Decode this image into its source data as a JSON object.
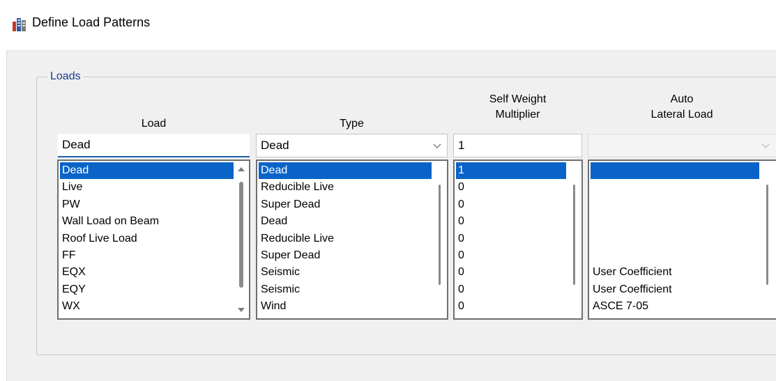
{
  "window": {
    "title": "Define Load Patterns"
  },
  "group": {
    "legend": "Loads"
  },
  "columns": {
    "load": {
      "header": "Load"
    },
    "type": {
      "header": "Type"
    },
    "self_weight": {
      "header_line1": "Self Weight",
      "header_line2": "Multiplier"
    },
    "auto_lateral": {
      "header_line1": "Auto",
      "header_line2": "Lateral Load"
    }
  },
  "inputs": {
    "load_name": "Dead",
    "type_selected": "Dead",
    "self_weight_value": "1",
    "auto_lateral_selected": ""
  },
  "lists": {
    "load": [
      "Dead",
      "Live",
      "PW",
      "Wall Load on Beam",
      "Roof Live Load",
      "FF",
      "EQX",
      "EQY",
      "WX"
    ],
    "type": [
      "Dead",
      "Reducible Live",
      "Super Dead",
      "Dead",
      "Reducible Live",
      "Super Dead",
      "Seismic",
      "Seismic",
      "Wind"
    ],
    "self_weight": [
      "1",
      "0",
      "0",
      "0",
      "0",
      "0",
      "0",
      "0",
      "0"
    ],
    "auto_lateral": [
      "",
      "",
      "",
      "",
      "",
      "",
      "User Coefficient",
      "User Coefficient",
      "ASCE 7-05"
    ]
  },
  "selected_row": 0,
  "colors": {
    "selection": "#0a64c8",
    "legend_text": "#1a3c8c",
    "input_underline": "#1f5fa8",
    "dialog_background": "#f0f0f0"
  },
  "icons": {
    "app": "building-icon",
    "dropdown": "chevron-down-icon",
    "scroll_up": "triangle-up-icon",
    "scroll_down": "triangle-down-icon"
  }
}
